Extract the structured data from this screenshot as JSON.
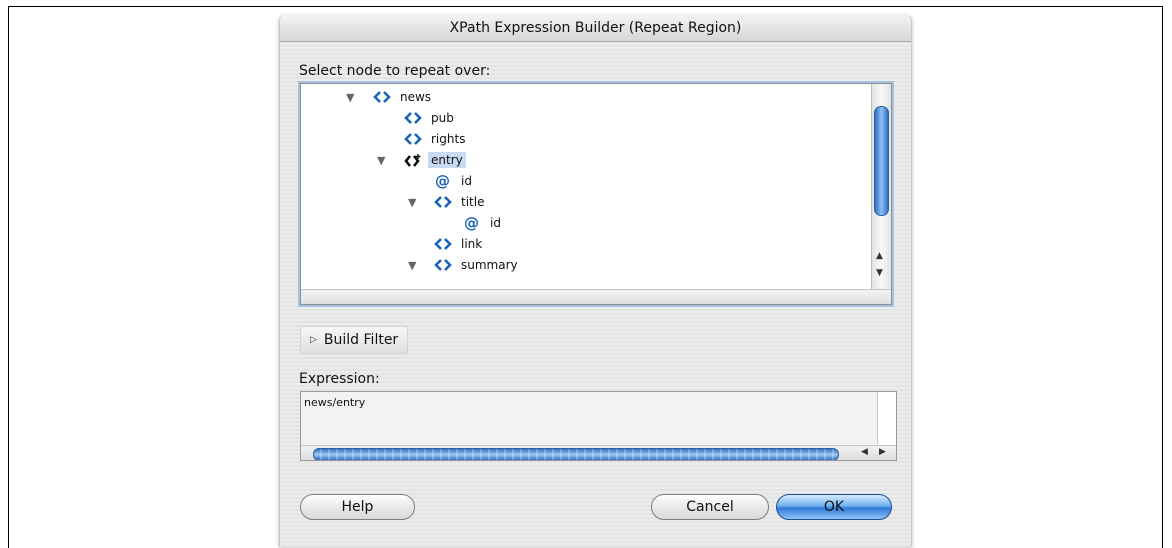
{
  "dialog": {
    "title": "XPath Expression Builder (Repeat Region)",
    "select_label": "Select node to repeat over:",
    "tree": [
      {
        "label": "news",
        "type": "element",
        "expanded": true
      },
      {
        "label": "pub",
        "type": "element"
      },
      {
        "label": "rights",
        "type": "element"
      },
      {
        "label": "entry",
        "type": "repeating-element",
        "expanded": true,
        "selected": true
      },
      {
        "label": "id",
        "type": "attribute"
      },
      {
        "label": "title",
        "type": "element",
        "expanded": true
      },
      {
        "label": "id",
        "type": "attribute"
      },
      {
        "label": "link",
        "type": "element"
      },
      {
        "label": "summary",
        "type": "element",
        "expanded": true
      }
    ],
    "build_filter_label": "Build Filter",
    "expression_label": "Expression:",
    "expression_value": "news/entry",
    "buttons": {
      "help": "Help",
      "cancel": "Cancel",
      "ok": "OK"
    },
    "colors": {
      "accent": "#2f7ad8",
      "selection": "#c8daf2",
      "element_icon": "#1a63b8"
    }
  }
}
